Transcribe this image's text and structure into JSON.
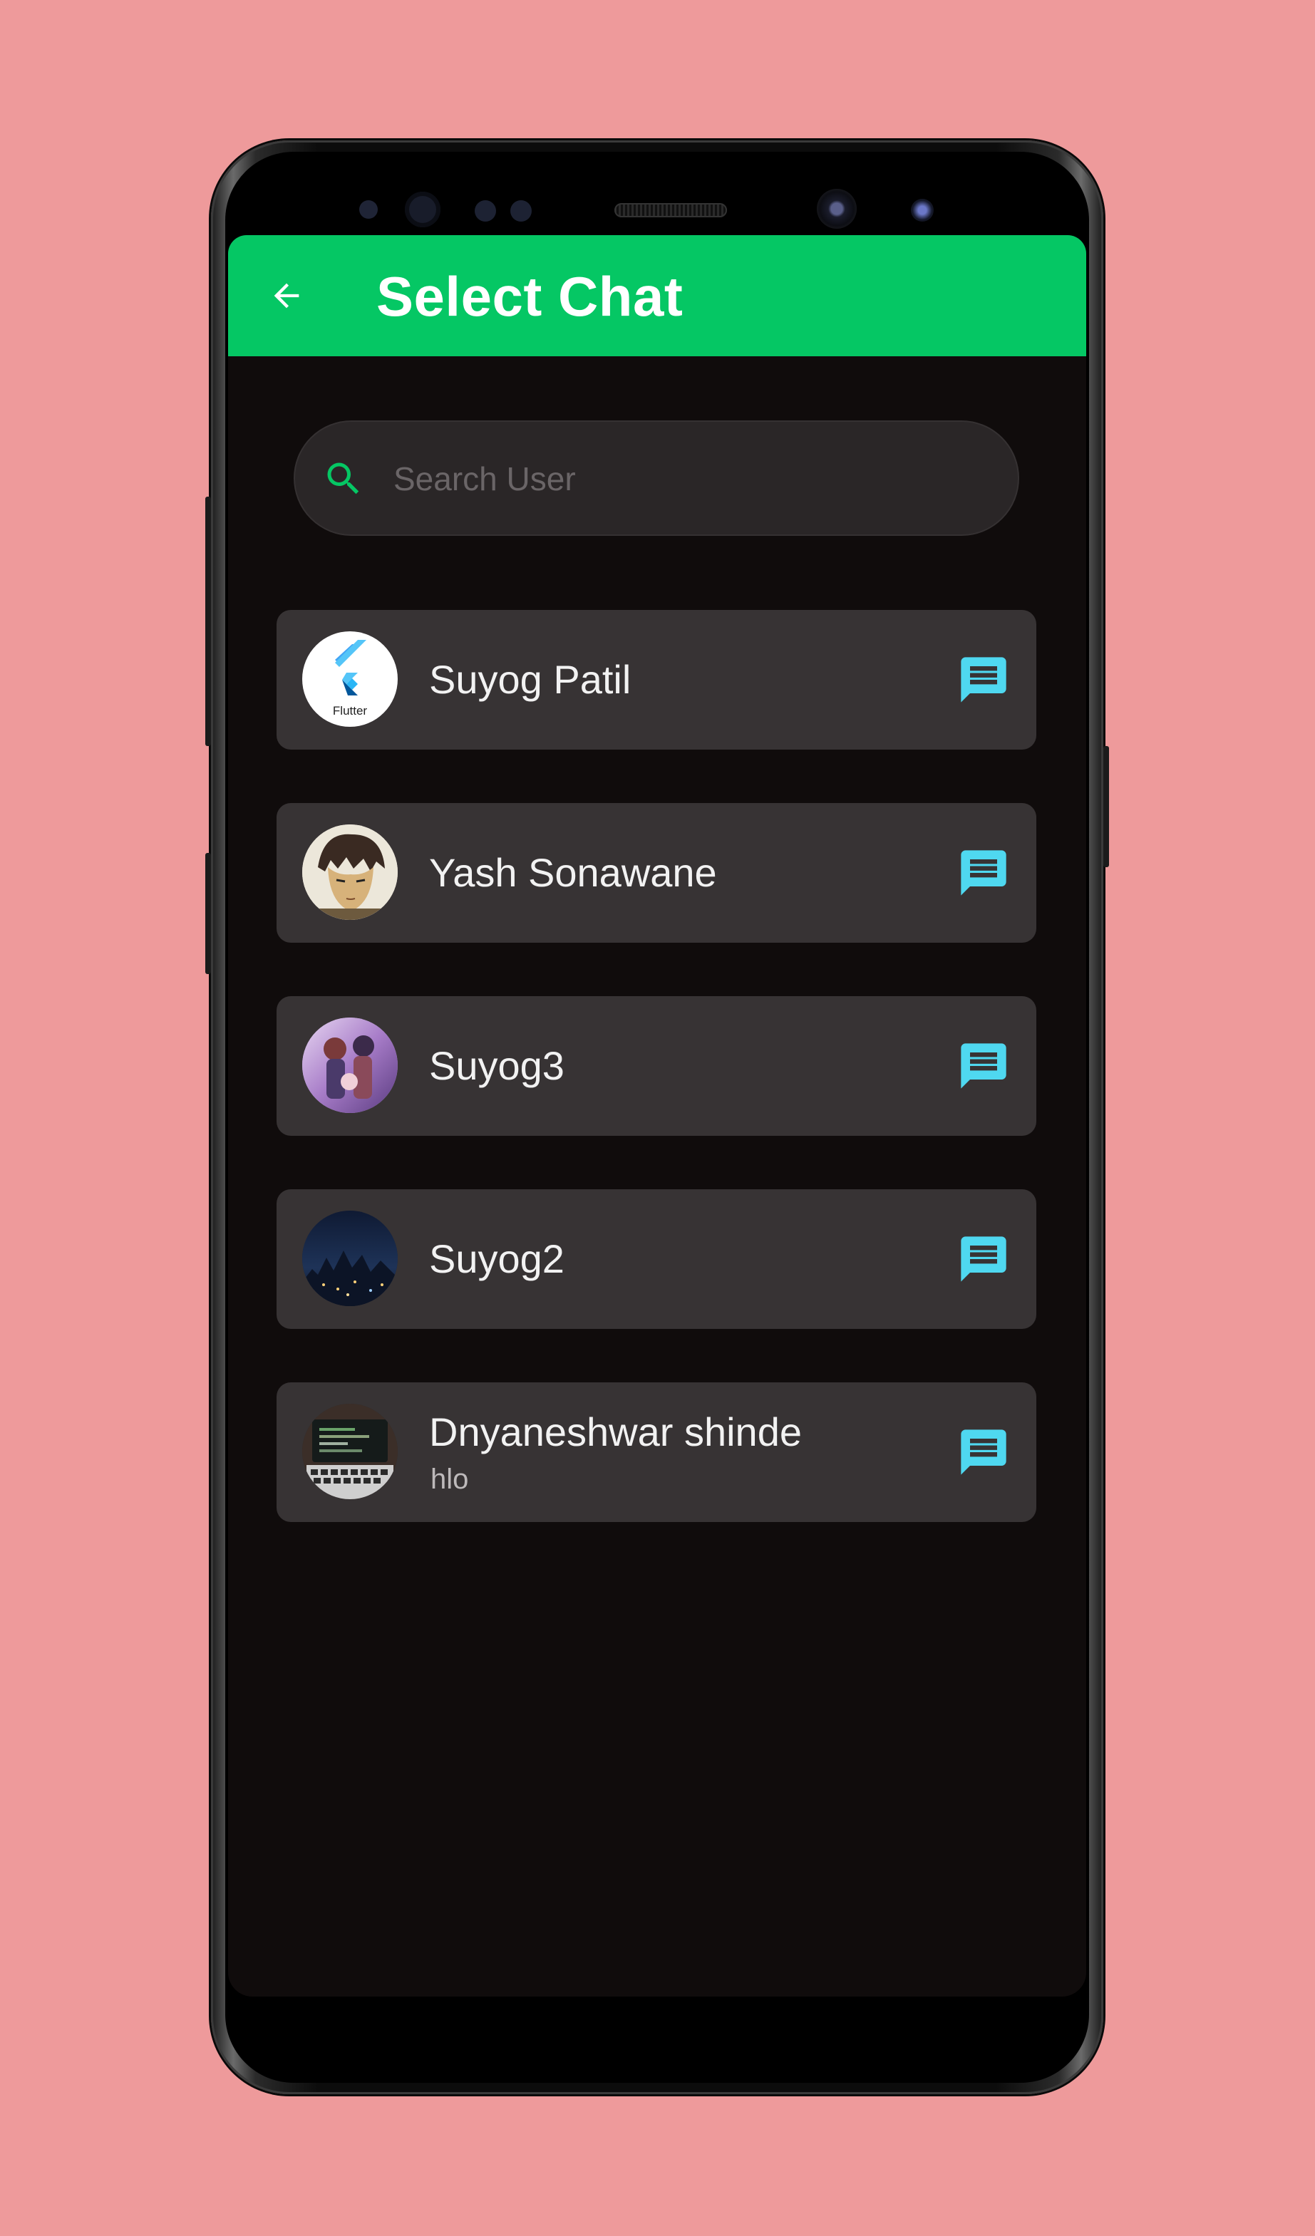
{
  "app_bar": {
    "title": "Select Chat",
    "background": "#05c764",
    "back_icon": "arrow-left-icon"
  },
  "search": {
    "placeholder": "Search User",
    "value": "",
    "icon": "search-icon",
    "icon_color": "#05c764"
  },
  "chats": [
    {
      "name": "Suyog Patil",
      "subtitle": "",
      "avatar": "flutter-logo-avatar",
      "avatar_text": "Flutter",
      "action_icon": "message-icon"
    },
    {
      "name": "Yash Sonawane",
      "subtitle": "",
      "avatar": "anime-character-avatar",
      "action_icon": "message-icon"
    },
    {
      "name": "Suyog3",
      "subtitle": "",
      "avatar": "anime-group-avatar",
      "action_icon": "message-icon"
    },
    {
      "name": "Suyog2",
      "subtitle": "",
      "avatar": "night-city-avatar",
      "action_icon": "message-icon"
    },
    {
      "name": "Dnyaneshwar shinde",
      "subtitle": "hlo",
      "avatar": "laptop-keyboard-avatar",
      "action_icon": "message-icon"
    }
  ],
  "colors": {
    "page_background": "#ee9a9b",
    "screen_background": "#100c0c",
    "card_background": "#373334",
    "accent_icon": "#4fd8f0"
  }
}
